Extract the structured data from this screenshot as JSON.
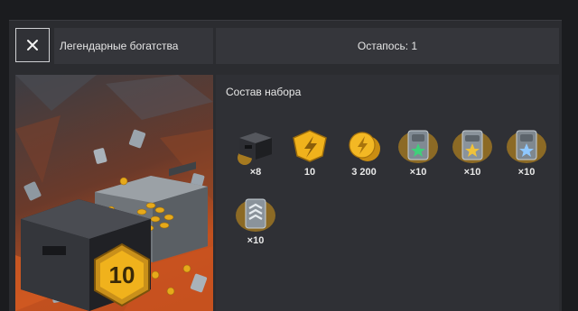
{
  "header": {
    "close_icon": "close-icon",
    "title": "Легендарные богатства",
    "remaining": "Остапось: 1"
  },
  "content": {
    "section_title": "Состав набора",
    "rewards": [
      {
        "icon": "dark-container-icon",
        "count": "×8"
      },
      {
        "icon": "tier-ten-badge-icon",
        "count": "10"
      },
      {
        "icon": "gold-coin-icon",
        "count": "3 200"
      },
      {
        "icon": "green-star-tank-card-icon",
        "count": "×10"
      },
      {
        "icon": "gold-star-tank-card-icon",
        "count": "×10"
      },
      {
        "icon": "silver-star-tank-card-icon",
        "count": "×10"
      },
      {
        "icon": "rank-chevron-card-icon",
        "count": "×10"
      }
    ]
  },
  "art": {
    "badge_text": "10"
  },
  "colors": {
    "background": "#1b1c1f",
    "panel": "#2f3035",
    "accent_gold": "#f0b21c",
    "art_orange": "#c2511f"
  }
}
